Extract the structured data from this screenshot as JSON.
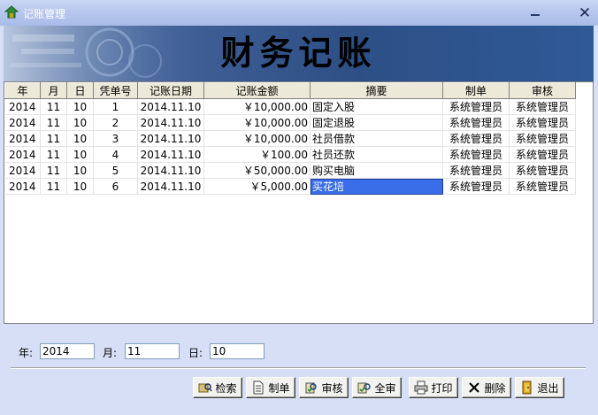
{
  "window": {
    "title": "记账管理"
  },
  "banner": {
    "title": "财务记账"
  },
  "table": {
    "columns": [
      "年",
      "月",
      "日",
      "凭单号",
      "记账日期",
      "记账金额",
      "摘要",
      "制单",
      "审核"
    ],
    "rows": [
      [
        "2014",
        "11",
        "10",
        "1",
        "2014.11.10",
        "￥10,000.00",
        "固定入股",
        "系统管理员",
        "系统管理员"
      ],
      [
        "2014",
        "11",
        "10",
        "2",
        "2014.11.10",
        "￥10,000.00",
        "固定退股",
        "系统管理员",
        "系统管理员"
      ],
      [
        "2014",
        "11",
        "10",
        "3",
        "2014.11.10",
        "￥10,000.00",
        "社员借款",
        "系统管理员",
        "系统管理员"
      ],
      [
        "2014",
        "11",
        "10",
        "4",
        "2014.11.10",
        "￥100.00",
        "社员还款",
        "系统管理员",
        "系统管理员"
      ],
      [
        "2014",
        "11",
        "10",
        "5",
        "2014.11.10",
        "￥50,000.00",
        "购买电脑",
        "系统管理员",
        "系统管理员"
      ],
      [
        "2014",
        "11",
        "10",
        "6",
        "2014.11.10",
        "￥5,000.00",
        "买花培",
        "系统管理员",
        "系统管理员"
      ]
    ]
  },
  "filter": {
    "year_label": "年:",
    "year_value": "2014",
    "month_label": "月:",
    "month_value": "11",
    "day_label": "日:",
    "day_value": "10"
  },
  "buttons": {
    "search": "检索",
    "create": "制单",
    "review": "审核",
    "review_all": "全审",
    "print": "打印",
    "delete": "删除",
    "exit": "退出"
  },
  "colors": {
    "selected": "#3a6ee8",
    "banner": "#2d4f86",
    "window_bg": "#d6dff5"
  },
  "icons": [
    "app-icon",
    "minimize-icon",
    "close-icon",
    "search-icon",
    "document-icon",
    "review-icon",
    "review-all-icon",
    "print-icon",
    "delete-icon",
    "exit-icon"
  ]
}
